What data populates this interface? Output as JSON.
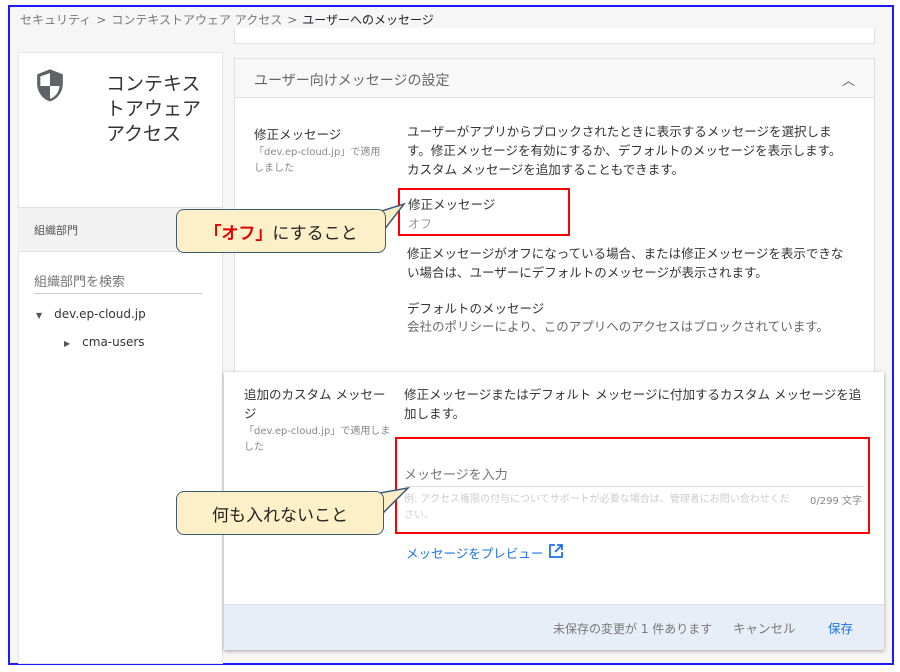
{
  "breadcrumb": {
    "items": [
      "セキュリティ",
      "コンテキストアウェア アクセス"
    ],
    "current": "ユーザーへのメッセージ",
    "separator": ">"
  },
  "sidebar": {
    "title": "コンテキストアウェア アクセス",
    "org_label": "組織部門",
    "search_placeholder": "組織部門を検索",
    "tree": [
      "dev.ep-cloud.jp",
      "cma-users"
    ]
  },
  "section": {
    "title": "ユーザー向けメッセージの設定",
    "remediation": {
      "label": "修正メッセージ",
      "applied": "「dev.ep-cloud.jp」で適用しました",
      "description": "ユーザーがアプリからブロックされたときに表示するメッセージを選択します。修正メッセージを有効にするか、デフォルトのメッセージを表示します。カスタム メッセージを追加することもできます。",
      "field_label": "修正メッセージ",
      "field_value": "オフ",
      "note": "修正メッセージがオフになっている場合、または修正メッセージを表示できない場合は、ユーザーにデフォルトのメッセージが表示されます。",
      "default_label": "デフォルトのメッセージ",
      "default_text": "会社のポリシーにより、このアプリへのアクセスはブロックされています。"
    },
    "custom": {
      "label": "追加のカスタム メッセージ",
      "applied": "「dev.ep-cloud.jp」で適用しました",
      "description": "修正メッセージまたはデフォルト メッセージに付加するカスタム メッセージを追加します。",
      "placeholder": "メッセージを入力",
      "hint": "例: アクセス権限の付与についてサポートが必要な場合は、管理者にお問い合わせください。",
      "counter": "0/299 文字",
      "preview_link": "メッセージをプレビュー"
    }
  },
  "footer": {
    "unsaved": "未保存の変更が 1 件あります",
    "cancel": "キャンセル",
    "save": "保存"
  },
  "annotations": {
    "off_em": "「オフ」",
    "off_rest": "にすること",
    "empty": "何も入れないこと"
  },
  "colors": {
    "accent": "#1a73e8",
    "highlight": "#ff0000",
    "callout_bg": "#fdf0c8"
  }
}
